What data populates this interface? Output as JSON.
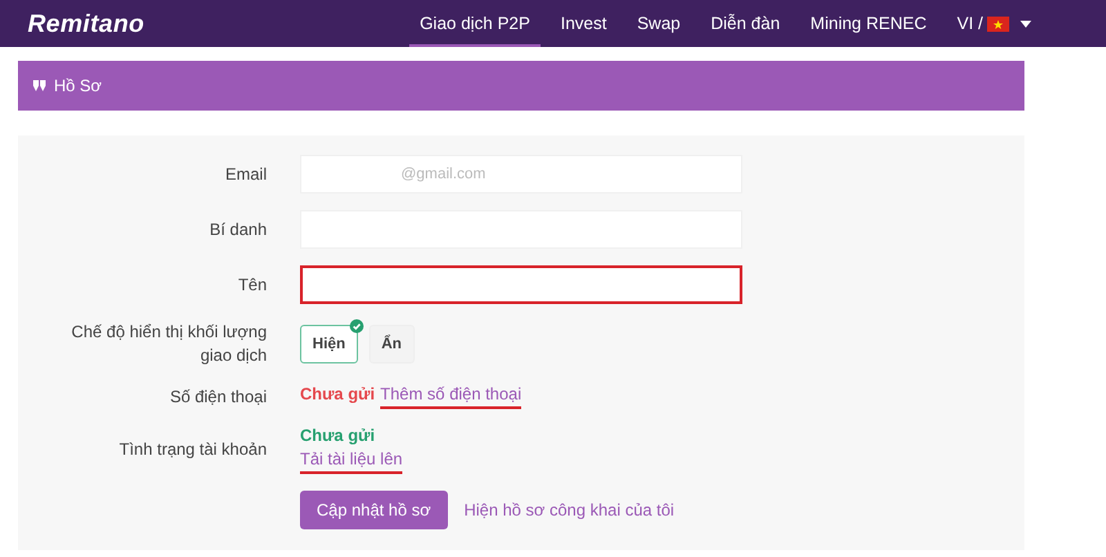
{
  "navbar": {
    "logo": "Remitano",
    "links": [
      {
        "label": "Giao dịch P2P",
        "selected": true
      },
      {
        "label": "Invest",
        "selected": false
      },
      {
        "label": "Swap",
        "selected": false
      },
      {
        "label": "Diễn đàn",
        "selected": false
      },
      {
        "label": "Mining RENEC",
        "selected": false
      }
    ],
    "language": "VI /"
  },
  "panel": {
    "title": "Hồ Sơ"
  },
  "form": {
    "rows": [
      {
        "kind": "input",
        "label": "Email",
        "value": "@gmail.com",
        "highlighted": false
      },
      {
        "kind": "input",
        "label": "Bí danh",
        "value": "",
        "highlighted": false
      },
      {
        "kind": "input",
        "label": "Tên",
        "value": "",
        "highlighted": true
      },
      {
        "kind": "toggle",
        "label": "Chế độ hiển thị khối lượng giao dịch",
        "options": [
          {
            "label": "Hiện",
            "selected": true
          },
          {
            "label": "Ẩn",
            "selected": false
          }
        ]
      },
      {
        "kind": "inline_status",
        "label": "Số điện thoại",
        "status": "Chưa gửi",
        "color": "#e5484d",
        "link": "Thêm số điện thoại",
        "underlined": true
      },
      {
        "kind": "stacked_status",
        "label": "Tình trạng tài khoản",
        "status": "Chưa gửi",
        "color": "#27a070",
        "link": "Tải tài liệu lên",
        "underlined": true
      }
    ],
    "submit": "Cập nhật hồ sơ",
    "public_link": "Hiện hồ sơ công khai của tôi"
  }
}
